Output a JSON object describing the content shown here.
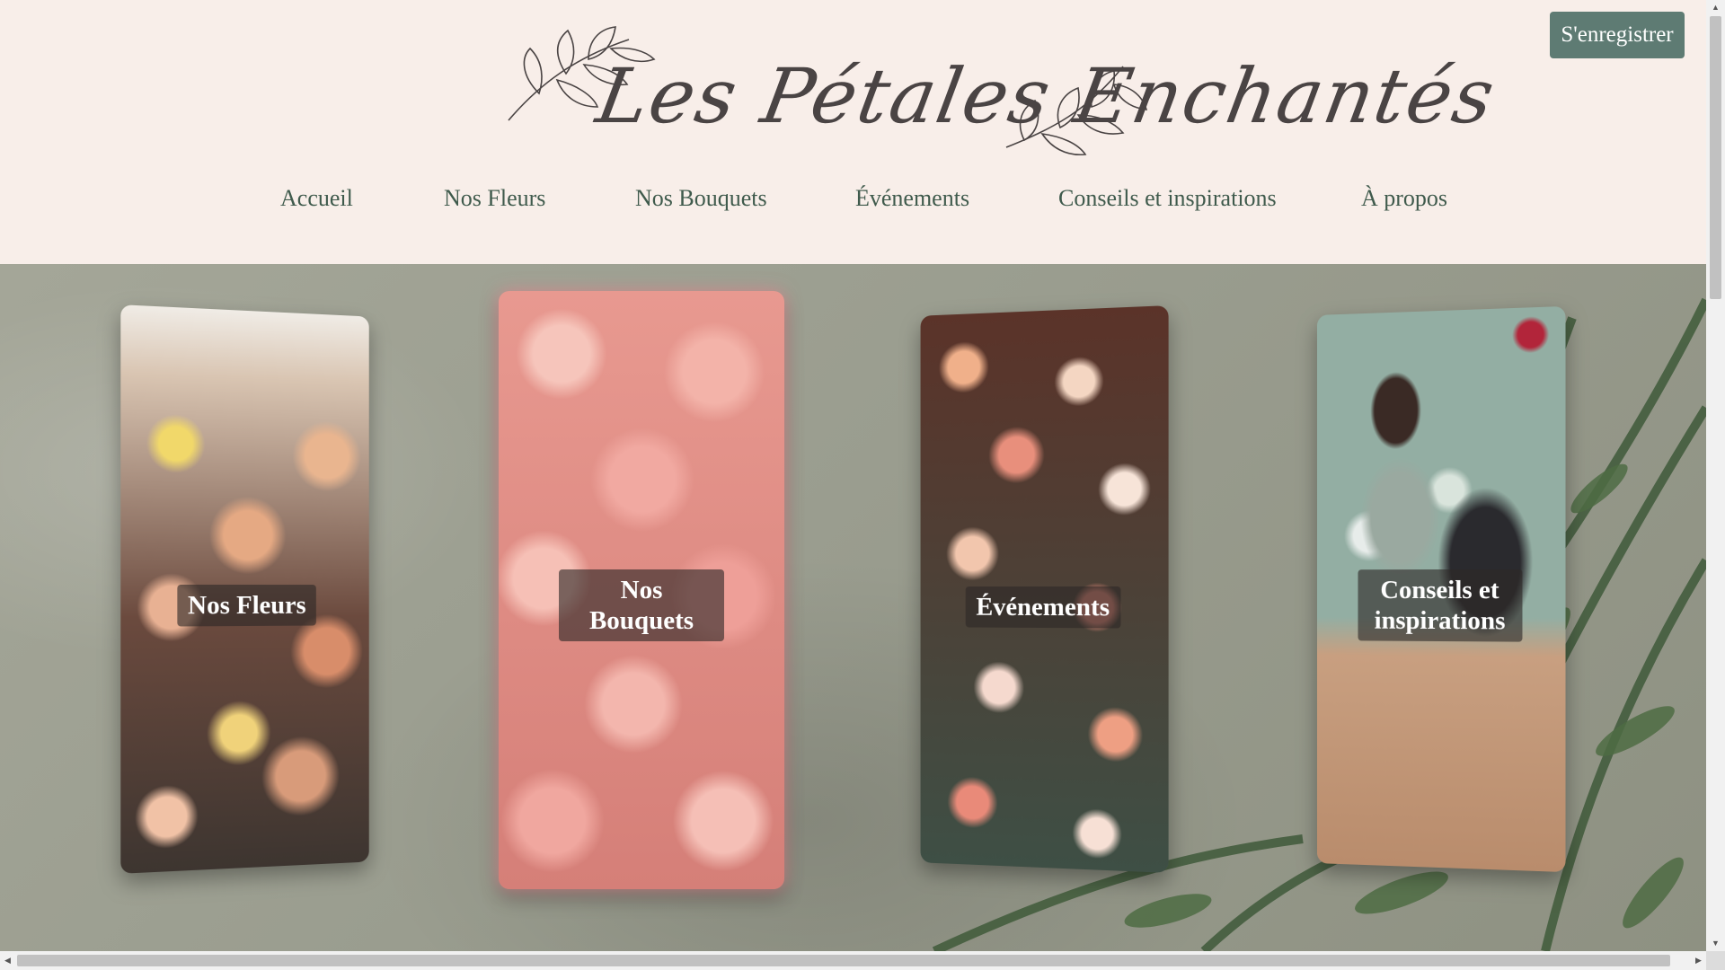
{
  "header": {
    "logo_text": "Les Pétales Enchantés",
    "register_label": "S'enregistrer"
  },
  "nav": {
    "items": [
      {
        "label": "Accueil"
      },
      {
        "label": "Nos Fleurs"
      },
      {
        "label": "Nos Bouquets"
      },
      {
        "label": "Événements"
      },
      {
        "label": "Conseils et inspirations"
      },
      {
        "label": "À propos"
      }
    ]
  },
  "hero": {
    "cards": [
      {
        "label": "Nos Fleurs"
      },
      {
        "label": "Nos Bouquets"
      },
      {
        "label": "Événements"
      },
      {
        "label": "Conseils et inspirations"
      }
    ]
  },
  "colors": {
    "background": "#f8eee9",
    "accent": "#5e7b73",
    "nav_text": "#3f5a4c",
    "logo_text": "#4a4444"
  }
}
